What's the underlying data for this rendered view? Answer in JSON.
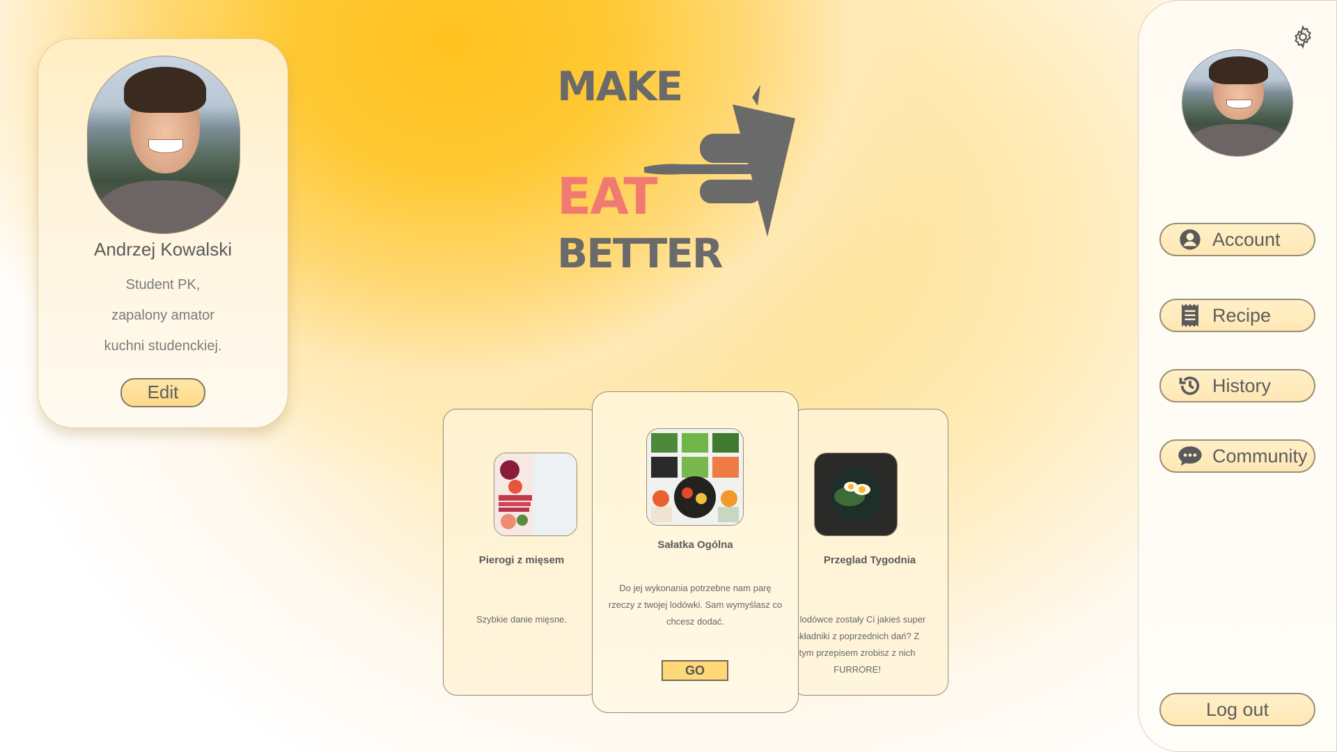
{
  "profile": {
    "name": "Andrzej Kowalski",
    "bio_lines": [
      "Student PK,",
      "zapalony amator",
      "kuchni studenckiej."
    ],
    "edit_label": "Edit"
  },
  "logo": {
    "make": "MAKE",
    "eat": "EAT",
    "better": "BETTER",
    "eat_color": "#f07a72",
    "text_color": "#6a6a6a"
  },
  "recipes": [
    {
      "title": "Pierogi z mięsem",
      "description": "Szybkie danie mięsne."
    },
    {
      "title": "Sałatka Ogólna",
      "description": "Do jej wykonania potrzebne nam parę rzeczy z twojej lodówki. Sam wymyślasz co chcesz dodać.",
      "action_label": "GO"
    },
    {
      "title": "Przeglad Tygodnia",
      "description": "W lodówce zostały Ci jakieś super składniki z poprzednich dań? Z tym przepisem zrobisz z nich FURRORE!"
    }
  ],
  "sidebar": {
    "settings_icon": "gear-icon",
    "nav": [
      {
        "label": "Account",
        "icon": "account-icon"
      },
      {
        "label": "Recipe",
        "icon": "receipt-icon"
      },
      {
        "label": "History",
        "icon": "history-icon"
      },
      {
        "label": "Community",
        "icon": "chat-icon"
      }
    ],
    "logout_label": "Log out"
  },
  "colors": {
    "accent": "#ffc21f",
    "button_fill": "#ffe7b4"
  }
}
